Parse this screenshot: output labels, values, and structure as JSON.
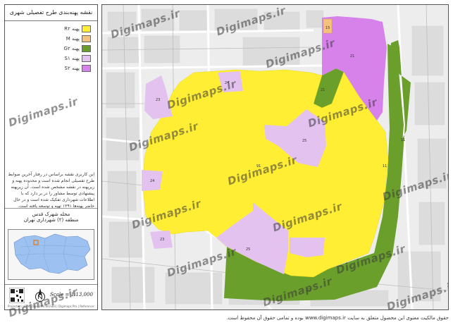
{
  "panel": {
    "title": "نقشه پهنه‌بندی طرح تفصیلی شهری",
    "legend": [
      {
        "label": "پهنه R۲",
        "color": "#ffee33"
      },
      {
        "label": "پهنه M",
        "color": "#f4c27a"
      },
      {
        "label": "پهنه G۲",
        "color": "#6a9f2b"
      },
      {
        "label": "پهنه S۱",
        "color": "#e3c2ef"
      },
      {
        "label": "پهنه S۲",
        "color": "#d782ea"
      }
    ],
    "description": "این کاربری نقشه براساس در رفتار آخرین ضوابط طرح تفصیلی انجام شده است و محدوده پهنه و زیرپهنه در نقشه مشخص شده است. آن زیرپهنه پیشنهادی توسط مشاور را در بر دارد که با اطلاعات شهرداری تفکیک شده است و در حال حاضر پهنه‌ها ۱۳۹۱ تهیه و توسعه یافته است.",
    "area_name": "محله شهرک قدس",
    "area_sub": "منطقه (۲) شهرداری تهران",
    "scale": "Scale = 1:13,000",
    "credit": "Projection: UTM Zone 39N WGS84 | Digimaps Pro | Reference: Tehran Municipality"
  },
  "map": {
    "zone_labels": [
      "15",
      "21",
      "21",
      "23",
      "24",
      "25",
      "91",
      "24",
      "23",
      "25",
      "11",
      "11",
      "22"
    ],
    "watermarks": [
      "Digimaps.ir",
      "Digimaps.ir",
      "Digimaps.ir",
      "Digimaps.ir",
      "Digimaps.ir",
      "Digimaps.ir",
      "Digimaps.ir",
      "Digimaps.ir",
      "Digimaps.ir",
      "Digimaps.ir",
      "Digimaps.ir",
      "Digimaps.ir",
      "Digimaps.ir",
      "Digimaps.ir"
    ]
  },
  "footer": {
    "text": "حقوق مالکیت معنوی این محصول متعلق به سایت www.digimaps.ir بوده و تمامی حقوق آن محفوظ است."
  },
  "colors": {
    "R2": "#ffee33",
    "M": "#f4c27a",
    "G2": "#6a9f2b",
    "S1": "#e3c2ef",
    "S2": "#d782ea",
    "road": "#ffffff",
    "block": "#dcdcdc",
    "inset_city": "#9dc2f2"
  }
}
